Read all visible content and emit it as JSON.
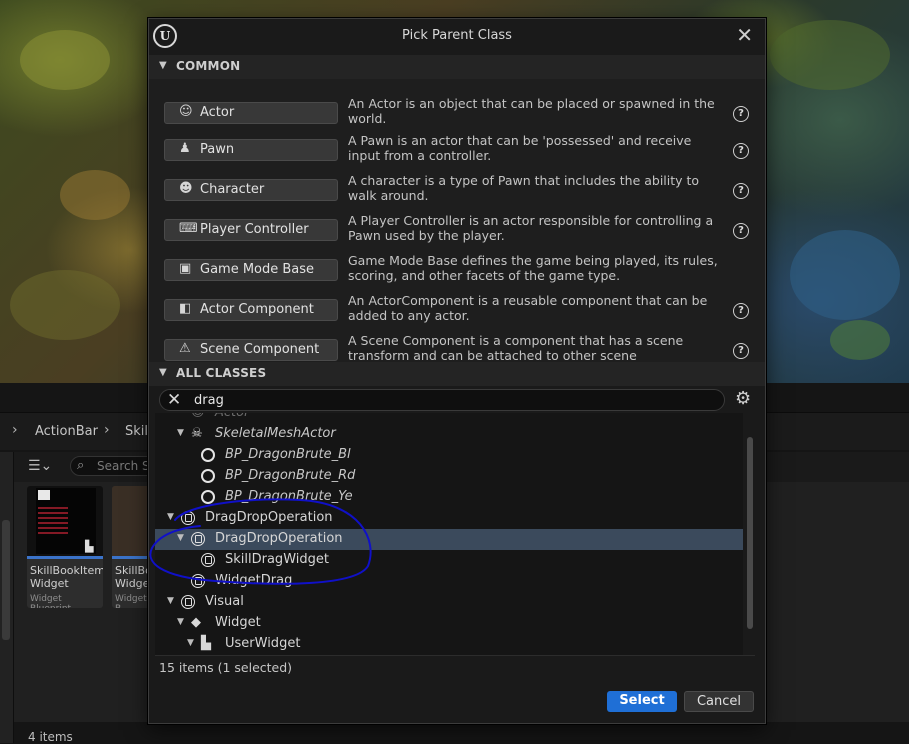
{
  "dialog": {
    "title": "Pick Parent Class",
    "logo": "ue-logo",
    "close_icon": "close-icon"
  },
  "common": {
    "header": "COMMON",
    "classes": [
      {
        "label": "Actor",
        "icon": "actor-icon",
        "glyph": "☺",
        "description": "An Actor is an object that can be placed or spawned in the world.",
        "help": true
      },
      {
        "label": "Pawn",
        "icon": "pawn-icon",
        "glyph": "♟",
        "description": "A Pawn is an actor that can be 'possessed' and receive input from a controller.",
        "help": true
      },
      {
        "label": "Character",
        "icon": "character-icon",
        "glyph": "☻",
        "description": "A character is a type of Pawn that includes the ability to walk around.",
        "help": true
      },
      {
        "label": "Player Controller",
        "icon": "gamepad-icon",
        "glyph": "⌨",
        "description": "A Player Controller is an actor responsible for controlling a Pawn used by the player.",
        "help": true
      },
      {
        "label": "Game Mode Base",
        "icon": "game-mode-icon",
        "glyph": "▣",
        "description": "Game Mode Base defines the game being played, its rules, scoring, and other facets of the game type.",
        "help": false
      },
      {
        "label": "Actor Component",
        "icon": "actor-component-icon",
        "glyph": "◧",
        "description": "An ActorComponent is a reusable component that can be added to any actor.",
        "help": true
      },
      {
        "label": "Scene Component",
        "icon": "scene-component-icon",
        "glyph": "⚠",
        "description": "A Scene Component is a component that has a scene transform and can be attached to other scene components.",
        "help": true
      }
    ]
  },
  "all_classes": {
    "header": "ALL CLASSES",
    "search_value": "drag",
    "tree": [
      {
        "label": "Actor",
        "indent": 1,
        "arrow": "",
        "icon": "actor-icon",
        "italic": true,
        "faded": true
      },
      {
        "label": "SkeletalMeshActor",
        "indent": 1,
        "arrow": "▼",
        "icon": "skeleton-icon",
        "italic": true
      },
      {
        "label": "BP_DragonBrute_Bl",
        "indent": 2,
        "arrow": "",
        "icon": "ring-icon",
        "italic": true
      },
      {
        "label": "BP_DragonBrute_Rd",
        "indent": 2,
        "arrow": "",
        "icon": "ring-icon",
        "italic": true
      },
      {
        "label": "BP_DragonBrute_Ye",
        "indent": 2,
        "arrow": "",
        "icon": "ring-icon",
        "italic": true
      },
      {
        "label": "DragDropOperation",
        "indent": 0,
        "arrow": "▼",
        "icon": "uobject-icon",
        "italic": false
      },
      {
        "label": "DragDropOperation",
        "indent": 1,
        "arrow": "▼",
        "icon": "uobject-icon",
        "italic": false,
        "selected": true
      },
      {
        "label": "SkillDragWidget",
        "indent": 2,
        "arrow": "",
        "icon": "uobject-icon",
        "italic": false
      },
      {
        "label": "WidgetDrag",
        "indent": 1,
        "arrow": "",
        "icon": "uobject-icon",
        "italic": false
      },
      {
        "label": "Visual",
        "indent": 0,
        "arrow": "▼",
        "icon": "uobject-icon",
        "italic": false
      },
      {
        "label": "Widget",
        "indent": 1,
        "arrow": "▼",
        "icon": "widget-icon",
        "italic": false
      },
      {
        "label": "UserWidget",
        "indent": 2,
        "arrow": "▼",
        "icon": "user-widget-icon",
        "italic": false
      }
    ],
    "status": "15 items (1 selected)"
  },
  "buttons": {
    "select": "Select",
    "cancel": "Cancel"
  },
  "content_browser": {
    "breadcrumbs": [
      "ActionBar",
      "Skil"
    ],
    "search_placeholder": "Search S",
    "tiles": [
      {
        "name": "SkillBookItem Widget",
        "type": "Widget Blueprint"
      },
      {
        "name": "SkillBo Widge",
        "type": "Widget B"
      }
    ],
    "count": "4 items"
  },
  "colors": {
    "accent_select": "#1f6fd6",
    "selected_row": "#3b4a5c",
    "annotation_ink": "#1010c8"
  }
}
